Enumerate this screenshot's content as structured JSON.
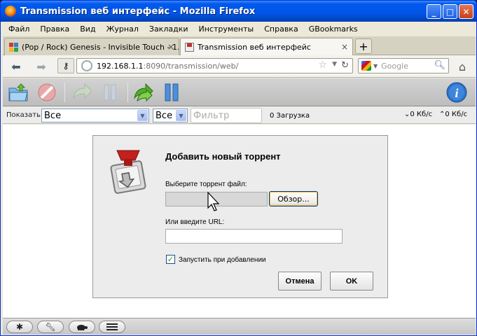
{
  "window": {
    "title": "Transmission веб интерфейс - Mozilla Firefox",
    "buttons": {
      "minimize": "_",
      "maximize": "□",
      "close": "✕"
    }
  },
  "menu": [
    "Файл",
    "Правка",
    "Вид",
    "Журнал",
    "Закладки",
    "Инструменты",
    "Справка",
    "GBookmarks"
  ],
  "tabs": [
    {
      "label": "(Pop / Rock) Genesis - Invisible Touch - 1...",
      "active": false
    },
    {
      "label": "Transmission веб интерфейс",
      "active": true
    }
  ],
  "new_tab_label": "+",
  "tab_close": "×",
  "navbar": {
    "url_host": "192.168.1.1",
    "url_path": ":8090/transmission/web/",
    "search_placeholder": "Google",
    "back_icon": "back-arrow-icon",
    "forward_icon": "forward-arrow-icon"
  },
  "toolbar": {
    "icons": [
      "open-torrent-icon",
      "remove-torrent-icon",
      "resume-icon",
      "pause-icon",
      "resume-all-icon",
      "pause-all-icon",
      "info-icon"
    ]
  },
  "filter": {
    "show_label": "Показать",
    "status_value": "Все",
    "tracker_value": "Все",
    "filter_placeholder": "Фильтр",
    "count": "0 Загрузка",
    "down_speed": "0 Кб/с",
    "up_speed": "0 Кб/с"
  },
  "dialog": {
    "title": "Добавить новый торрент",
    "file_label": "Выберите торрент файл:",
    "browse_label": "Обзор...",
    "url_label": "Или введите URL:",
    "url_value": "",
    "start_label": "Запустить при добавлении",
    "start_checked": true,
    "cancel_label": "Отмена",
    "ok_label": "OK"
  },
  "bottombar": {
    "icons": [
      "settings-gear-icon",
      "wrench-icon",
      "turtle-icon",
      "list-icon"
    ]
  }
}
